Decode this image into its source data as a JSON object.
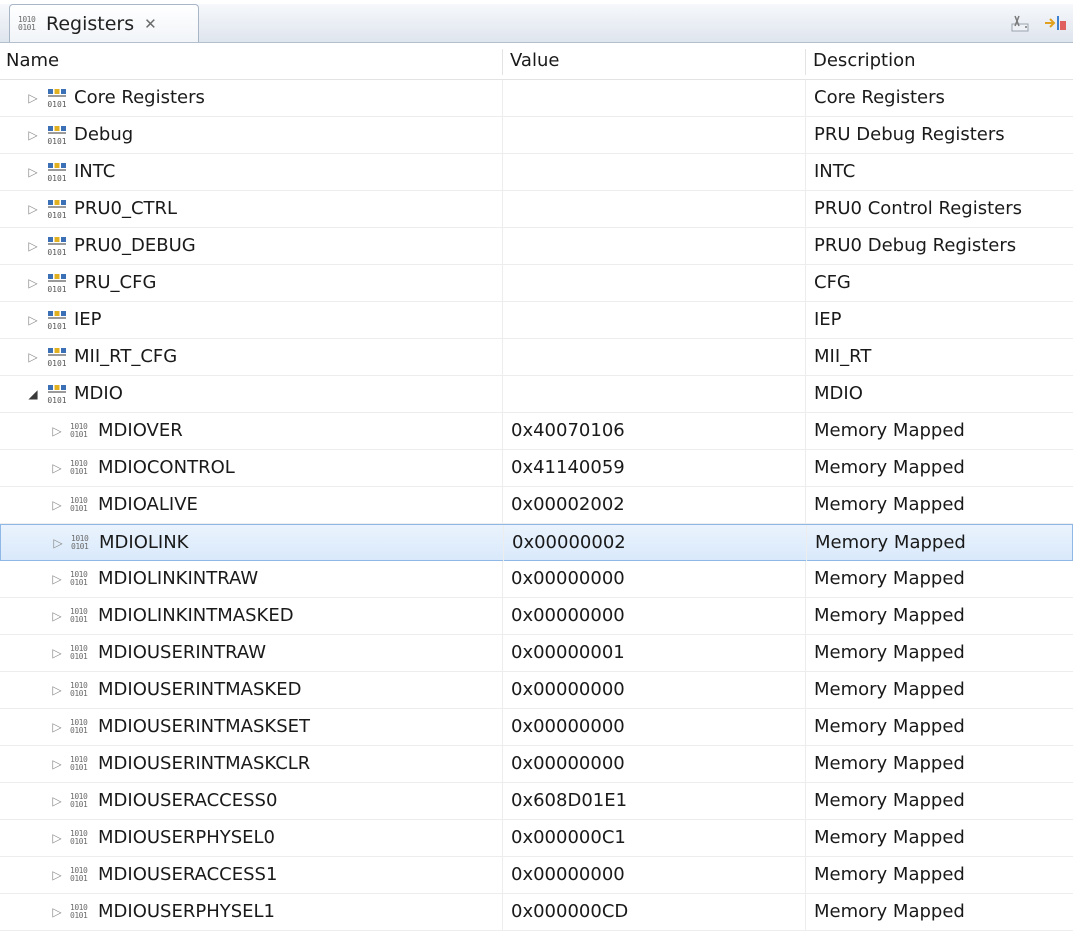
{
  "view": {
    "tab_title": "Registers",
    "tab_icon_bits": [
      "1010",
      "0101"
    ]
  },
  "columns": {
    "name": "Name",
    "value": "Value",
    "description": "Description"
  },
  "rows": [
    {
      "name": "Core Registers",
      "value": "",
      "description": "Core Registers",
      "kind": "group",
      "level": 0,
      "expanded": false,
      "selected": false
    },
    {
      "name": "Debug",
      "value": "",
      "description": "PRU Debug Registers",
      "kind": "group",
      "level": 0,
      "expanded": false,
      "selected": false
    },
    {
      "name": "INTC",
      "value": "",
      "description": "INTC",
      "kind": "group",
      "level": 0,
      "expanded": false,
      "selected": false
    },
    {
      "name": "PRU0_CTRL",
      "value": "",
      "description": "PRU0 Control Registers",
      "kind": "group",
      "level": 0,
      "expanded": false,
      "selected": false
    },
    {
      "name": "PRU0_DEBUG",
      "value": "",
      "description": "PRU0 Debug Registers",
      "kind": "group",
      "level": 0,
      "expanded": false,
      "selected": false
    },
    {
      "name": "PRU_CFG",
      "value": "",
      "description": "CFG",
      "kind": "group",
      "level": 0,
      "expanded": false,
      "selected": false
    },
    {
      "name": "IEP",
      "value": "",
      "description": "IEP",
      "kind": "group",
      "level": 0,
      "expanded": false,
      "selected": false
    },
    {
      "name": "MII_RT_CFG",
      "value": "",
      "description": "MII_RT",
      "kind": "group",
      "level": 0,
      "expanded": false,
      "selected": false
    },
    {
      "name": "MDIO",
      "value": "",
      "description": "MDIO",
      "kind": "group",
      "level": 0,
      "expanded": true,
      "selected": false
    },
    {
      "name": "MDIOVER",
      "value": "0x40070106",
      "description": "Memory Mapped",
      "kind": "register",
      "level": 1,
      "expanded": false,
      "selected": false
    },
    {
      "name": "MDIOCONTROL",
      "value": "0x41140059",
      "description": "Memory Mapped",
      "kind": "register",
      "level": 1,
      "expanded": false,
      "selected": false
    },
    {
      "name": "MDIOALIVE",
      "value": "0x00002002",
      "description": "Memory Mapped",
      "kind": "register",
      "level": 1,
      "expanded": false,
      "selected": false
    },
    {
      "name": "MDIOLINK",
      "value": "0x00000002",
      "description": "Memory Mapped",
      "kind": "register",
      "level": 1,
      "expanded": false,
      "selected": true
    },
    {
      "name": "MDIOLINKINTRAW",
      "value": "0x00000000",
      "description": "Memory Mapped",
      "kind": "register",
      "level": 1,
      "expanded": false,
      "selected": false
    },
    {
      "name": "MDIOLINKINTMASKED",
      "value": "0x00000000",
      "description": "Memory Mapped",
      "kind": "register",
      "level": 1,
      "expanded": false,
      "selected": false
    },
    {
      "name": "MDIOUSERINTRAW",
      "value": "0x00000001",
      "description": "Memory Mapped",
      "kind": "register",
      "level": 1,
      "expanded": false,
      "selected": false
    },
    {
      "name": "MDIOUSERINTMASKED",
      "value": "0x00000000",
      "description": "Memory Mapped",
      "kind": "register",
      "level": 1,
      "expanded": false,
      "selected": false
    },
    {
      "name": "MDIOUSERINTMASKSET",
      "value": "0x00000000",
      "description": "Memory Mapped",
      "kind": "register",
      "level": 1,
      "expanded": false,
      "selected": false
    },
    {
      "name": "MDIOUSERINTMASKCLR",
      "value": "0x00000000",
      "description": "Memory Mapped",
      "kind": "register",
      "level": 1,
      "expanded": false,
      "selected": false
    },
    {
      "name": "MDIOUSERACCESS0",
      "value": "0x608D01E1",
      "description": "Memory Mapped",
      "kind": "register",
      "level": 1,
      "expanded": false,
      "selected": false
    },
    {
      "name": "MDIOUSERPHYSEL0",
      "value": "0x000000C1",
      "description": "Memory Mapped",
      "kind": "register",
      "level": 1,
      "expanded": false,
      "selected": false
    },
    {
      "name": "MDIOUSERACCESS1",
      "value": "0x00000000",
      "description": "Memory Mapped",
      "kind": "register",
      "level": 1,
      "expanded": false,
      "selected": false
    },
    {
      "name": "MDIOUSERPHYSEL1",
      "value": "0x000000CD",
      "description": "Memory Mapped",
      "kind": "register",
      "level": 1,
      "expanded": false,
      "selected": false
    }
  ],
  "colors": {
    "selection": "#d9e9fb",
    "selection_border": "#8fb8e6",
    "group_icon_blue": "#3b6fb6",
    "group_icon_yellow": "#e0b020"
  },
  "icons": {
    "group": "register-group-icon",
    "register": "register-binary-icon",
    "collapsed": "collapsed-triangle-icon",
    "expanded": "expanded-triangle-icon"
  }
}
